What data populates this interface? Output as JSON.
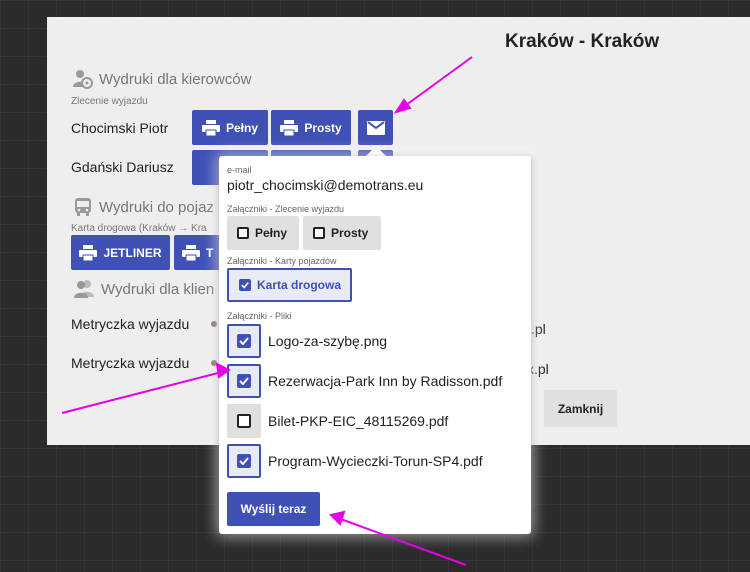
{
  "header": {
    "title": "Kraków - Kraków"
  },
  "drivers": {
    "heading": "Wydruki dla kierowców",
    "sublabel": "Zlecenie wyjazdu",
    "rows": [
      {
        "name": "Chocimski Piotr",
        "btn_full": "Pełny",
        "btn_simple": "Prosty"
      },
      {
        "name": "Gdański Dariusz"
      }
    ]
  },
  "vehicles": {
    "heading": "Wydruki do pojaz",
    "sublabel": "Karta drogowa (Kraków → Kra",
    "btn_jetliner": "JETLINER",
    "btn_second": "T"
  },
  "clients": {
    "heading": "Wydruki dla klien",
    "rows": [
      {
        "name": "Metryczka wyjazdu",
        "tail": ".pl"
      },
      {
        "name": "Metryczka wyjazdu",
        "tail": "x.pl"
      }
    ]
  },
  "close_button": "Zamknij",
  "popup": {
    "email_label": "e-mail",
    "email_value": "piotr_chocimski@demotrans.eu",
    "order_label": "Załączniki - Zlecenie wyjazdu",
    "order_options": [
      {
        "label": "Pełny",
        "checked": false
      },
      {
        "label": "Prosty",
        "checked": false
      }
    ],
    "vehicle_label": "Załączniki - Karty pojazdów",
    "vehicle_options": [
      {
        "label": "Karta drogowa",
        "checked": true
      }
    ],
    "files_label": "Załączniki - Pliki",
    "files": [
      {
        "name": "Logo-za-szybę.png",
        "checked": true
      },
      {
        "name": "Rezerwacja-Park Inn by Radisson.pdf",
        "checked": true
      },
      {
        "name": "Bilet-PKP-EIC_48115269.pdf",
        "checked": false
      },
      {
        "name": "Program-Wycieczki-Torun-SP4.pdf",
        "checked": true
      }
    ],
    "send_button": "Wyślij teraz"
  },
  "colors": {
    "primary": "#3f51b5",
    "annotation": "#e600e6",
    "panel": "#eeeeee",
    "backdrop": "#2b2b2b"
  }
}
